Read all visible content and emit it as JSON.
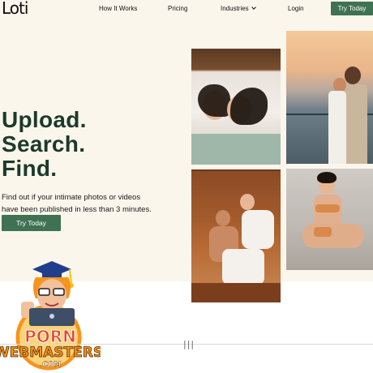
{
  "brand": {
    "logo_text": "Loti"
  },
  "nav": {
    "items": [
      {
        "label": "How It Works"
      },
      {
        "label": "Pricing"
      },
      {
        "label": "Industries"
      },
      {
        "label": "Login"
      }
    ],
    "cta_label": "Try Today"
  },
  "hero": {
    "headline_line1": "Upload.",
    "headline_line2": "Search.",
    "headline_line3": "Find.",
    "subtext": "Find out if your intimate photos or videos have been published in less than 3 minutes.",
    "cta_label": "Try Today"
  },
  "watermark": {
    "line1": "PORN",
    "line2": "WEBMASTERS",
    "line3": ".COM"
  },
  "colors": {
    "accent": "#3f7252",
    "headline": "#1c3a2a",
    "hero_bg": "#fbf6ec"
  }
}
